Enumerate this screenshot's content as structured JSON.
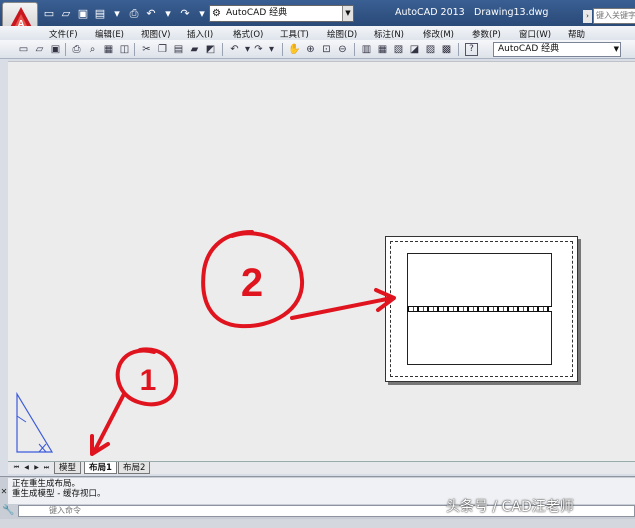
{
  "titlebar": {
    "workspace_name": "AutoCAD 经典",
    "app_name": "AutoCAD 2013",
    "document_name": "Drawing13.dwg",
    "search_placeholder": "键入关键字"
  },
  "menubar": {
    "items": [
      "文件(F)",
      "编辑(E)",
      "视图(V)",
      "插入(I)",
      "格式(O)",
      "工具(T)",
      "绘图(D)",
      "标注(N)",
      "修改(M)",
      "参数(P)",
      "窗口(W)",
      "帮助"
    ]
  },
  "toolbar": {
    "workspace_combo": "AutoCAD 经典",
    "help_icon_label": "?"
  },
  "tabs": {
    "model": "模型",
    "layout1": "布局1",
    "layout2": "布局2",
    "active": "布局1"
  },
  "command": {
    "history": [
      "正在重生成布局。",
      "重生成模型 - 缓存视口。"
    ],
    "input_placeholder": "键入命令"
  },
  "annotations": {
    "circle1_label": "1",
    "circle2_label": "2",
    "color": "#e0141e"
  },
  "watermark": "头条号 / CAD汪老师",
  "colors": {
    "titlebar": "#2f5284",
    "canvas": "#ececec",
    "annotation_red": "#e0141e"
  }
}
